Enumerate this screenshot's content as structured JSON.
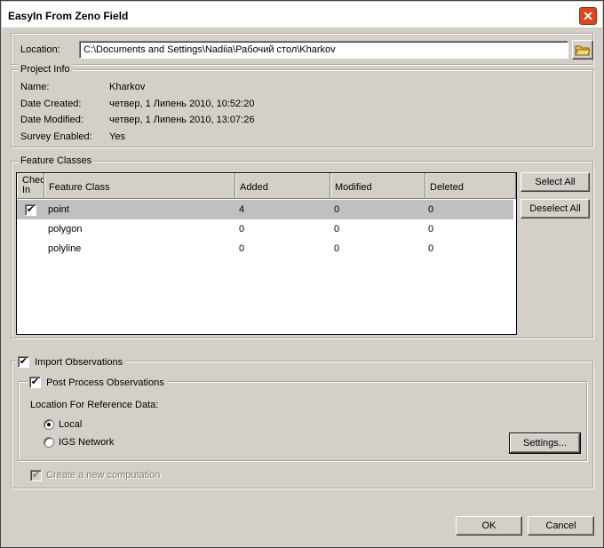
{
  "window": {
    "title": "EasyIn From Zeno Field",
    "close_glyph": "✕"
  },
  "location": {
    "label": "Location:",
    "value": "C:\\Documents and Settings\\Nadiia\\Рабочий стол\\Kharkov"
  },
  "project_info": {
    "legend": "Project Info",
    "rows": [
      {
        "label": "Name:",
        "value": "Kharkov"
      },
      {
        "label": "Date Created:",
        "value": "четвер, 1 Липень 2010, 10:52:20"
      },
      {
        "label": "Date Modified:",
        "value": "четвер, 1 Липень 2010, 13:07:26"
      },
      {
        "label": "Survey Enabled:",
        "value": "Yes"
      }
    ]
  },
  "feature_classes": {
    "legend": "Feature Classes",
    "columns": [
      "Check In",
      "Feature Class",
      "Added",
      "Modified",
      "Deleted"
    ],
    "check_col_top": "Chec",
    "check_col_bottom": "In",
    "rows": [
      {
        "checked": true,
        "feature_class": "point",
        "added": "4",
        "modified": "0",
        "deleted": "0"
      },
      {
        "checked": false,
        "feature_class": "polygon",
        "added": "0",
        "modified": "0",
        "deleted": "0"
      },
      {
        "checked": false,
        "feature_class": "polyline",
        "added": "0",
        "modified": "0",
        "deleted": "0"
      }
    ],
    "select_all": "Select All",
    "deselect_all": "Deselect All"
  },
  "import": {
    "label": "Import Observations",
    "post_process_label": "Post Process Observations",
    "reference_label": "Location For Reference Data:",
    "radio_local": "Local",
    "radio_igs": "IGS Network",
    "selected": "Local",
    "settings_button": "Settings...",
    "create_computation": "Create a new computation"
  },
  "footer": {
    "ok": "OK",
    "cancel": "Cancel"
  },
  "checkmark": "✔"
}
